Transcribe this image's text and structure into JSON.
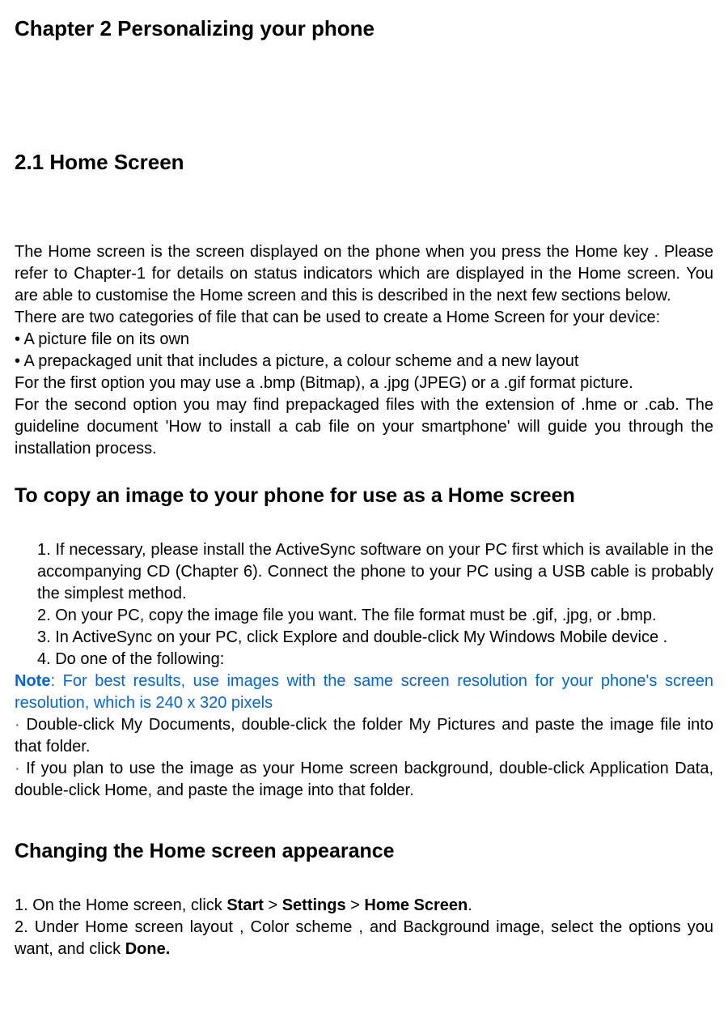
{
  "chapter_title": "Chapter 2 Personalizing your phone",
  "section_2_1_title": "2.1 Home Screen",
  "intro_p1": "The Home screen is the screen displayed on the phone when you press the Home key . Please refer to Chapter-1 for details on status indicators which are displayed in the Home screen. You are able to customise the Home screen and this is described in the next few sections below.",
  "intro_p2": "There are two categories of file that can be used to create a Home Screen for your device:",
  "bullet1": "• A picture file on its own",
  "bullet2": "• A prepackaged unit that includes a picture, a colour scheme and a new layout",
  "intro_p3": "For the first option you may use a .bmp (Bitmap), a .jpg (JPEG) or a .gif format picture.",
  "intro_p4": "For the second option you may find prepackaged files with the extension of .hme or .cab. The guideline document 'How to install a cab file on your smartphone' will guide you through the installation process.",
  "copy_heading": "To copy an image to your phone for use as a Home screen",
  "step1": "1. If necessary, please install the ActiveSync software on your PC first which is available in the accompanying CD (Chapter 6). Connect the phone to your PC using a USB cable is probably the simplest method.",
  "step2": "2. On your PC, copy the image file you want. The file format must be .gif, .jpg, or .bmp.",
  "step3": "3. In ActiveSync on your PC, click Explore and double-click My Windows Mobile device .",
  "step4": "4. Do one of the following:",
  "note_prefix": "Note",
  "note_body": ": For best results, use images with the same screen resolution for your phone's screen resolution, which is 240 x 320 pixels",
  "dot_item1": " Double-click My Documents, double-click the folder My Pictures and paste the image file into that folder.",
  "dot_item2": " If you plan to use the image as your Home screen background, double-click Application Data, double-click Home, and paste the image into that folder.",
  "changing_heading": "Changing the Home screen appearance",
  "change_1_pre": "1. On the Home screen, click ",
  "change_1_start": "Start",
  "change_1_sep": " > ",
  "change_1_settings": "Settings",
  "change_1_home": "Home Screen",
  "change_1_end": ".",
  "change_2_pre": "2. Under Home screen layout , Color scheme , and Background image, select the options you want, and click ",
  "change_2_done": "Done."
}
